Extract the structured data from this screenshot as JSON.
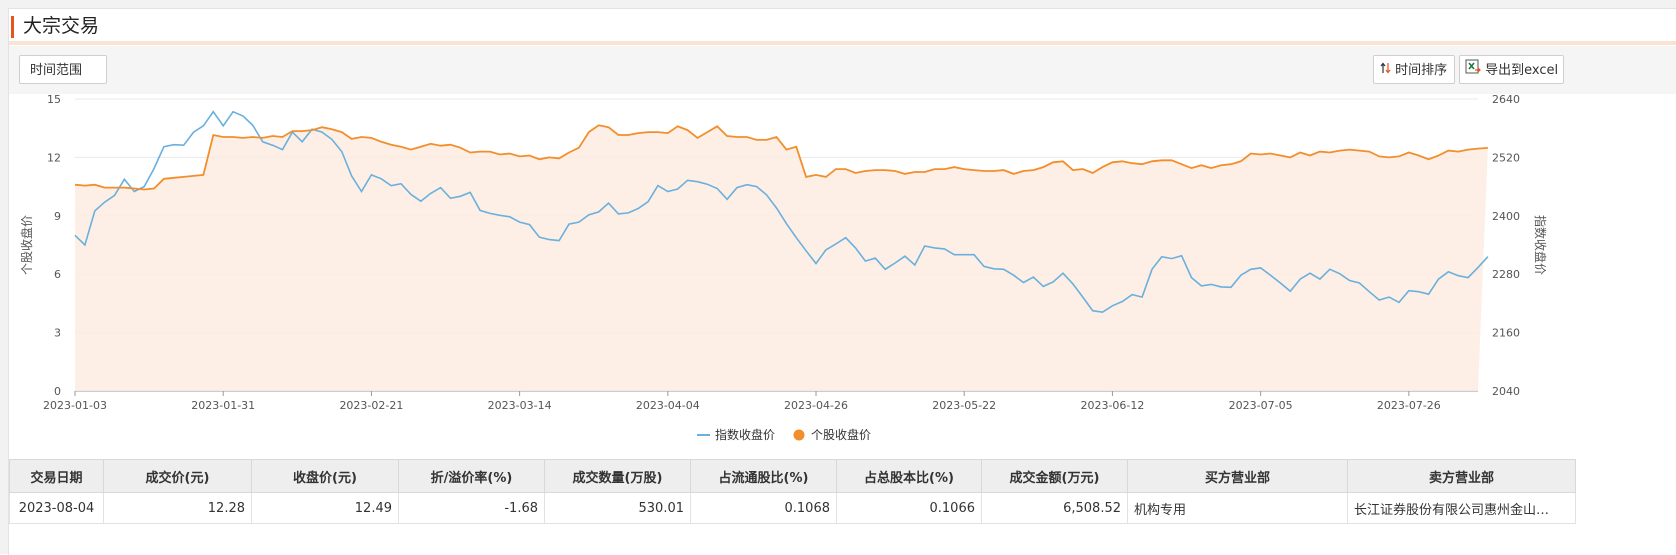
{
  "page": {
    "title": "大宗交易"
  },
  "toolbar": {
    "range_label": "时间范围",
    "sort_label": "时间排序",
    "export_label": "导出到excel"
  },
  "chart_data": {
    "type": "line",
    "x": [
      "2023-01-03",
      "2023-01-04",
      "2023-01-05",
      "2023-01-06",
      "2023-01-09",
      "2023-01-10",
      "2023-01-11",
      "2023-01-12",
      "2023-01-13",
      "2023-01-16",
      "2023-01-17",
      "2023-01-18",
      "2023-01-19",
      "2023-01-20",
      "2023-01-30",
      "2023-01-31",
      "2023-02-01",
      "2023-02-02",
      "2023-02-03",
      "2023-02-06",
      "2023-02-07",
      "2023-02-08",
      "2023-02-09",
      "2023-02-10",
      "2023-02-13",
      "2023-02-14",
      "2023-02-15",
      "2023-02-16",
      "2023-02-17",
      "2023-02-20",
      "2023-02-21",
      "2023-02-22",
      "2023-02-23",
      "2023-02-24",
      "2023-02-27",
      "2023-02-28",
      "2023-03-01",
      "2023-03-02",
      "2023-03-03",
      "2023-03-06",
      "2023-03-07",
      "2023-03-08",
      "2023-03-09",
      "2023-03-10",
      "2023-03-13",
      "2023-03-14",
      "2023-03-15",
      "2023-03-16",
      "2023-03-17",
      "2023-03-20",
      "2023-03-21",
      "2023-03-22",
      "2023-03-23",
      "2023-03-24",
      "2023-03-27",
      "2023-03-28",
      "2023-03-29",
      "2023-03-30",
      "2023-03-31",
      "2023-04-03",
      "2023-04-04",
      "2023-04-06",
      "2023-04-07",
      "2023-04-10",
      "2023-04-11",
      "2023-04-12",
      "2023-04-13",
      "2023-04-14",
      "2023-04-17",
      "2023-04-18",
      "2023-04-19",
      "2023-04-20",
      "2023-04-21",
      "2023-04-24",
      "2023-04-25",
      "2023-04-26",
      "2023-04-27",
      "2023-04-28",
      "2023-05-04",
      "2023-05-05",
      "2023-05-08",
      "2023-05-09",
      "2023-05-10",
      "2023-05-11",
      "2023-05-12",
      "2023-05-15",
      "2023-05-16",
      "2023-05-17",
      "2023-05-18",
      "2023-05-19",
      "2023-05-22",
      "2023-05-23",
      "2023-05-24",
      "2023-05-25",
      "2023-05-26",
      "2023-05-29",
      "2023-05-30",
      "2023-05-31",
      "2023-06-01",
      "2023-06-02",
      "2023-06-05",
      "2023-06-06",
      "2023-06-07",
      "2023-06-08",
      "2023-06-09",
      "2023-06-12",
      "2023-06-13",
      "2023-06-14",
      "2023-06-15",
      "2023-06-16",
      "2023-06-19",
      "2023-06-20",
      "2023-06-21",
      "2023-06-26",
      "2023-06-27",
      "2023-06-28",
      "2023-06-29",
      "2023-06-30",
      "2023-07-03",
      "2023-07-04",
      "2023-07-05",
      "2023-07-06",
      "2023-07-07",
      "2023-07-10",
      "2023-07-11",
      "2023-07-12",
      "2023-07-13",
      "2023-07-14",
      "2023-07-17",
      "2023-07-18",
      "2023-07-19",
      "2023-07-20",
      "2023-07-21",
      "2023-07-24",
      "2023-07-25",
      "2023-07-26",
      "2023-07-27",
      "2023-07-28",
      "2023-07-31",
      "2023-08-01",
      "2023-08-02",
      "2023-08-03",
      "2023-08-04"
    ],
    "x_ticks": [
      "2023-01-03",
      "2023-01-31",
      "2023-02-21",
      "2023-03-14",
      "2023-04-04",
      "2023-04-26",
      "2023-05-22",
      "2023-06-12",
      "2023-07-05",
      "2023-07-26"
    ],
    "ylabel": "个股收盘价",
    "ylabel_right": "指数收盘价",
    "ylim": [
      0,
      15
    ],
    "yticks": [
      "0",
      "3",
      "6",
      "9",
      "12",
      "15"
    ],
    "ylim_right": [
      2040,
      2640
    ],
    "yticks_right": [
      "2040",
      "2160",
      "2280",
      "2400",
      "2520",
      "2640"
    ],
    "grid": true,
    "legend": "bottom-center",
    "series": [
      {
        "name": "指数收盘价",
        "axis": "right",
        "color": "#6ab0de",
        "values": [
          2360,
          2340,
          2410,
          2428,
          2442,
          2475,
          2450,
          2460,
          2497,
          2542,
          2546,
          2545,
          2572,
          2585,
          2614,
          2585,
          2614,
          2605,
          2586,
          2552,
          2545,
          2536,
          2572,
          2552,
          2578,
          2572,
          2557,
          2532,
          2482,
          2450,
          2484,
          2476,
          2462,
          2466,
          2444,
          2430,
          2446,
          2458,
          2436,
          2440,
          2448,
          2411,
          2405,
          2401,
          2398,
          2387,
          2382,
          2356,
          2351,
          2349,
          2383,
          2387,
          2402,
          2408,
          2426,
          2404,
          2406,
          2415,
          2429,
          2462,
          2450,
          2455,
          2473,
          2470,
          2465,
          2456,
          2434,
          2458,
          2464,
          2460,
          2443,
          2416,
          2384,
          2355,
          2328,
          2302,
          2330,
          2342,
          2355,
          2334,
          2307,
          2313,
          2290,
          2303,
          2317,
          2299,
          2338,
          2334,
          2332,
          2320,
          2320,
          2320,
          2296,
          2291,
          2290,
          2278,
          2263,
          2274,
          2255,
          2264,
          2282,
          2260,
          2233,
          2205,
          2202,
          2215,
          2224,
          2238,
          2233,
          2290,
          2316,
          2312,
          2318,
          2273,
          2256,
          2259,
          2254,
          2253,
          2278,
          2290,
          2293,
          2278,
          2262,
          2245,
          2270,
          2282,
          2270,
          2290,
          2281,
          2267,
          2262,
          2244,
          2227,
          2233,
          2222,
          2246,
          2244,
          2239,
          2270,
          2285,
          2277,
          2273,
          2294,
          2316
        ]
      },
      {
        "name": "个股收盘价",
        "axis": "left",
        "color": "#f28e2b",
        "values": [
          10.6,
          10.55,
          10.6,
          10.45,
          10.45,
          10.45,
          10.4,
          10.35,
          10.4,
          10.9,
          10.95,
          11.0,
          11.05,
          11.1,
          13.15,
          13.05,
          13.05,
          13.0,
          13.05,
          13.0,
          13.1,
          13.05,
          13.35,
          13.35,
          13.4,
          13.55,
          13.45,
          13.3,
          12.95,
          13.05,
          13.0,
          12.8,
          12.65,
          12.55,
          12.4,
          12.55,
          12.7,
          12.6,
          12.65,
          12.5,
          12.25,
          12.3,
          12.3,
          12.15,
          12.2,
          12.05,
          12.1,
          11.9,
          12.0,
          11.95,
          12.25,
          12.5,
          13.3,
          13.65,
          13.55,
          13.15,
          13.15,
          13.25,
          13.3,
          13.3,
          13.25,
          13.6,
          13.4,
          13.0,
          13.3,
          13.6,
          13.1,
          13.05,
          13.05,
          12.9,
          12.9,
          13.05,
          12.4,
          12.55,
          11.0,
          11.1,
          11.0,
          11.4,
          11.4,
          11.2,
          11.3,
          11.35,
          11.35,
          11.3,
          11.15,
          11.25,
          11.25,
          11.4,
          11.4,
          11.5,
          11.4,
          11.35,
          11.3,
          11.3,
          11.35,
          11.15,
          11.3,
          11.35,
          11.5,
          11.75,
          11.8,
          11.35,
          11.4,
          11.2,
          11.5,
          11.75,
          11.8,
          11.7,
          11.65,
          11.8,
          11.85,
          11.85,
          11.65,
          11.45,
          11.6,
          11.45,
          11.6,
          11.65,
          11.8,
          12.2,
          12.15,
          12.2,
          12.1,
          12.0,
          12.25,
          12.1,
          12.3,
          12.25,
          12.35,
          12.4,
          12.35,
          12.3,
          12.05,
          12.0,
          12.05,
          12.25,
          12.1,
          11.9,
          12.1,
          12.35,
          12.3,
          12.4,
          12.45,
          12.49
        ]
      }
    ]
  },
  "table": {
    "headers": [
      "交易日期",
      "成交价(元)",
      "收盘价(元)",
      "折/溢价率(%)",
      "成交数量(万股)",
      "占流通股比(%)",
      "占总股本比(%)",
      "成交金额(万元)",
      "买方营业部",
      "卖方营业部"
    ],
    "rows": [
      [
        "2023-08-04",
        "12.28",
        "12.49",
        "-1.68",
        "530.01",
        "0.1068",
        "0.1066",
        "6,508.52",
        "机构专用",
        "长江证券股份有限公司惠州金山…"
      ]
    ]
  }
}
